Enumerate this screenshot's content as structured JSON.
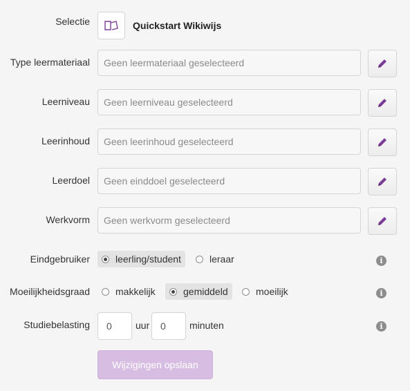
{
  "colors": {
    "accent": "#7b3d96",
    "save_button_bg": "#d6bde1"
  },
  "selectie": {
    "label": "Selectie",
    "title": "Quickstart Wikiwijs",
    "icon": "book-icon"
  },
  "fields": [
    {
      "label": "Type leermateriaal",
      "value": "Geen leermateriaal geselecteerd"
    },
    {
      "label": "Leerniveau",
      "value": "Geen leerniveau geselecteerd"
    },
    {
      "label": "Leerinhoud",
      "value": "Geen leerinhoud geselecteerd"
    },
    {
      "label": "Leerdoel",
      "value": "Geen einddoel geselecteerd"
    },
    {
      "label": "Werkvorm",
      "value": "Geen werkvorm geselecteerd"
    }
  ],
  "eindgebruiker": {
    "label": "Eindgebruiker",
    "options": [
      "leerling/student",
      "leraar"
    ],
    "selected": "leerling/student"
  },
  "moeilijkheidsgraad": {
    "label": "Moeilijkheidsgraad",
    "options": [
      "makkelijk",
      "gemiddeld",
      "moeilijk"
    ],
    "selected": "gemiddeld"
  },
  "studiebelasting": {
    "label": "Studiebelasting",
    "hours_value": "0",
    "hours_unit": "uur",
    "minutes_value": "0",
    "minutes_unit": "minuten"
  },
  "save_label": "Wijzigingen opslaan"
}
